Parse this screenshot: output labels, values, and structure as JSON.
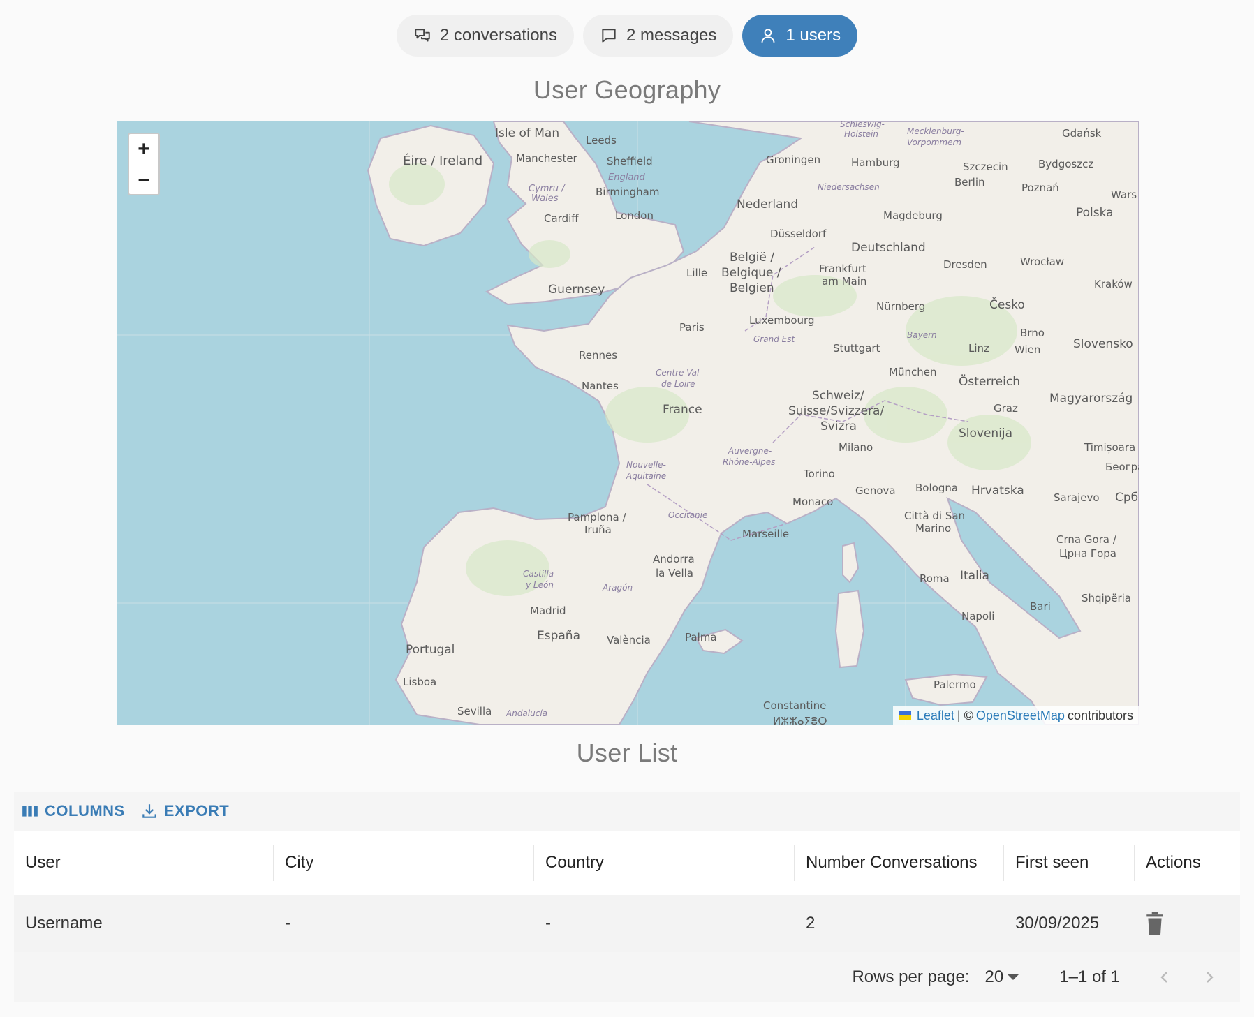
{
  "pills": [
    {
      "icon": "conversations-icon",
      "label": "2 conversations"
    },
    {
      "icon": "message-icon",
      "label": "2 messages"
    },
    {
      "icon": "user-icon",
      "label": "1 users",
      "active": true
    }
  ],
  "map_section": {
    "title": "User Geography",
    "zoom_in": "+",
    "zoom_out": "−",
    "attribution": {
      "leaflet": "Leaflet",
      "separator": " | © ",
      "osm": "OpenStreetMap",
      "suffix": "contributors"
    },
    "labels": {
      "isle_of_man": "Isle of Man",
      "leeds": "Leeds",
      "eire": "Éire / Ireland",
      "manchester": "Manchester",
      "sheffield": "Sheffield",
      "england": "England",
      "cymru": "Cymru /",
      "wales": "Wales",
      "birmingham": "Birmingham",
      "cardiff": "Cardiff",
      "london": "London",
      "guernsey": "Guernsey",
      "schleswig": "Schleswig-",
      "holstein": "Holstein",
      "mecklenburg": "Mecklenburg-",
      "vorpommern": "Vorpommern",
      "gdansk": "Gdańsk",
      "groningen": "Groningen",
      "hamburg": "Hamburg",
      "szczecin": "Szczecin",
      "bydgoszcz": "Bydgoszcz",
      "niedersachsen": "Niedersachsen",
      "berlin": "Berlin",
      "poznan": "Poznań",
      "wars": "Wars",
      "nederland": "Nederland",
      "polska": "Polska",
      "magdeburg": "Magdeburg",
      "dusseldorf": "Düsseldorf",
      "deutschland": "Deutschland",
      "belgie": "België /",
      "belgique": "Belgique /",
      "belgien": "Belgien",
      "lille": "Lille",
      "frankfurt": "Frankfurt",
      "am_main": "am Main",
      "dresden": "Dresden",
      "wroclaw": "Wrocław",
      "krakow": "Kraków",
      "nurnberg": "Nürnberg",
      "cesko": "Česko",
      "paris": "Paris",
      "luxembourg": "Luxembourg",
      "bayern": "Bayern",
      "brno": "Brno",
      "grand_est": "Grand Est",
      "stuttgart": "Stuttgart",
      "linz": "Linz",
      "wien": "Wien",
      "slovensko": "Slovensko",
      "rennes": "Rennes",
      "centre_val": "Centre-Val",
      "de_loire": "de Loire",
      "munchen": "München",
      "osterreich": "Österreich",
      "nantes": "Nantes",
      "schweiz": "Schweiz/",
      "suisse": "Suisse/Svizzera/",
      "svizra": "Svizra",
      "magyarorszag": "Magyarország",
      "graz": "Graz",
      "france": "France",
      "slovenija": "Slovenija",
      "milano": "Milano",
      "auvergne": "Auvergne-",
      "rhone": "Rhône-Alpes",
      "timisoara": "Timișoara",
      "beogr": "Београ",
      "nouvelle": "Nouvelle-",
      "aquitaine": "Aquitaine",
      "torino": "Torino",
      "bologna": "Bologna",
      "genova": "Genova",
      "hrvatska": "Hrvatska",
      "sarajevo": "Sarajevo",
      "srb": "Срб",
      "monaco": "Monaco",
      "pamplona": "Pamplona /",
      "iruna": "Iruña",
      "occitanie": "Occitanie",
      "citta": "Città di San",
      "marino": "Marino",
      "marseille": "Marseille",
      "crna": "Crna Gora /",
      "crna2": "Црна Гора",
      "andorra": "Andorra",
      "la_vella": "la Vella",
      "castilla": "Castilla",
      "y_leon": "y León",
      "aragon": "Aragón",
      "roma": "Roma",
      "italia": "Italia",
      "shqiperia": "Shqipëria",
      "madrid": "Madrid",
      "bari": "Bari",
      "espana": "España",
      "napoli": "Napoli",
      "valencia": "València",
      "palma": "Palma",
      "portugal": "Portugal",
      "lisboa": "Lisboa",
      "palermo": "Palermo",
      "constantine": "Constantine",
      "sevilla": "Sevilla",
      "andalucia": "Andalucía",
      "bottom_cut": "ⵍⵣⵣⴰⵢⴻⵔ"
    }
  },
  "user_list": {
    "title": "User List",
    "toolbar": {
      "columns": "COLUMNS",
      "export": "EXPORT"
    },
    "columns": [
      "User",
      "City",
      "Country",
      "Number Conversations",
      "First seen",
      "Actions"
    ],
    "rows": [
      {
        "user": "Username",
        "city": "-",
        "country": "-",
        "conversations": "2",
        "first_seen": "30/09/2025"
      }
    ],
    "footer": {
      "rows_per_page_label": "Rows per page:",
      "rows_per_page": "20",
      "range": "1–1 of 1"
    }
  },
  "colors": {
    "accent": "#3f80ba",
    "link": "#2b7bb9",
    "sea": "#aad3df",
    "land": "#f2efe9"
  }
}
